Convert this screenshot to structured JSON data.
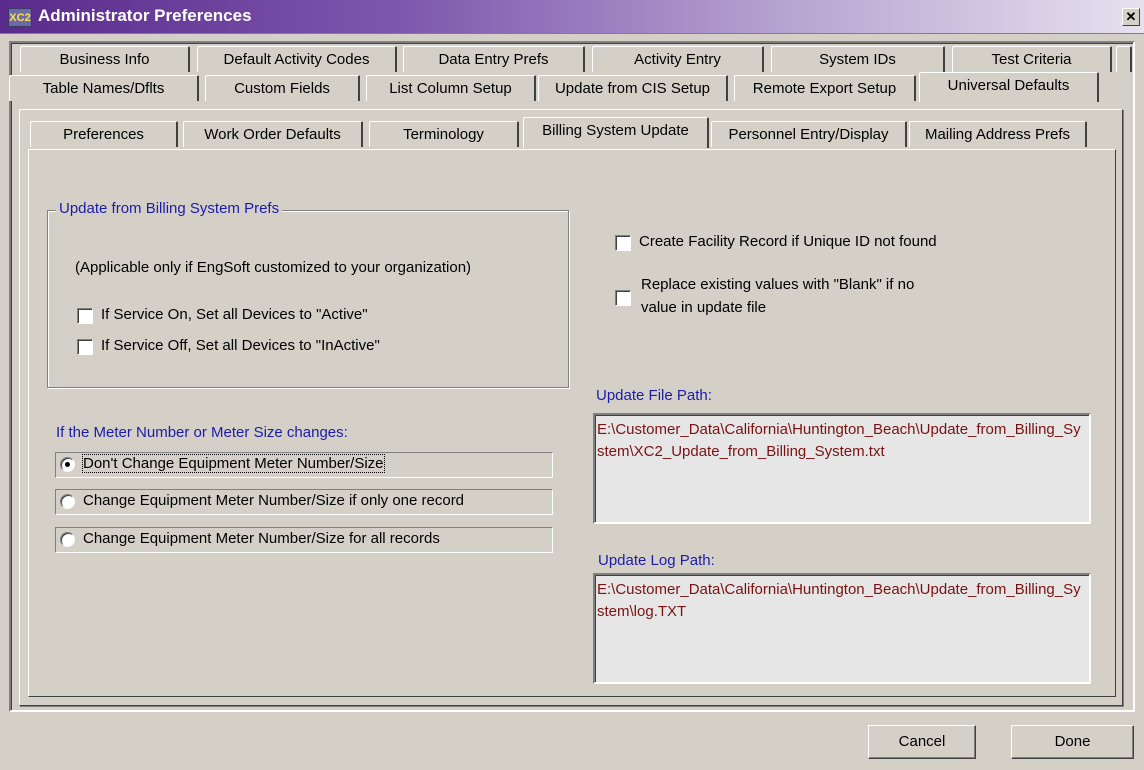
{
  "window": {
    "title": "Administrator Preferences",
    "app_icon_text": "XC2"
  },
  "tabs_row1": [
    "Business Info",
    "Default Activity Codes",
    "Data Entry Prefs",
    "Activity Entry",
    "System IDs",
    "Test Criteria"
  ],
  "tabs_row2": [
    "Table Names/Dflts",
    "Custom Fields",
    "List Column Setup",
    "Update from CIS Setup",
    "Remote Export Setup",
    "Universal Defaults"
  ],
  "sub_tabs": [
    "Preferences",
    "Work Order Defaults",
    "Terminology",
    "Billing System Update",
    "Personnel Entry/Display",
    "Mailing Address Prefs"
  ],
  "active_tab": "Universal Defaults",
  "active_sub_tab": "Billing System Update",
  "billing_prefs": {
    "group_title": "Update from Billing System Prefs",
    "note": "(Applicable only if EngSoft customized to your organization)",
    "service_on_label": "If Service On, Set all Devices to \"Active\"",
    "service_on_checked": false,
    "service_off_label": "If Service Off, Set all Devices to \"InActive\"",
    "service_off_checked": false
  },
  "meter_section": {
    "heading": "If the Meter Number or Meter Size changes:",
    "options": [
      "Don't Change Equipment Meter Number/Size",
      "Change Equipment Meter Number/Size if only one record",
      "Change Equipment Meter Number/Size for all records"
    ],
    "selected_index": 0
  },
  "create_facility": {
    "label": "Create Facility Record if Unique ID not found",
    "checked": false
  },
  "replace_values": {
    "line1": "Replace existing values with \"Blank\" if no",
    "line2": "value in update file",
    "checked": false
  },
  "update_file": {
    "label": "Update File Path:",
    "value": "E:\\Customer_Data\\California\\Huntington_Beach\\Update_from_Billing_System\\XC2_Update_from_Billing_System.txt"
  },
  "update_log": {
    "label": "Update Log Path:",
    "value": "E:\\Customer_Data\\California\\Huntington_Beach\\Update_from_Billing_System\\log.TXT"
  },
  "buttons": {
    "cancel": "Cancel",
    "done": "Done"
  },
  "colors": {
    "face": "#d4d0c8",
    "label_blue": "#1c1ca8",
    "path_text": "#7a1212",
    "title_start": "#5a2a8c"
  }
}
